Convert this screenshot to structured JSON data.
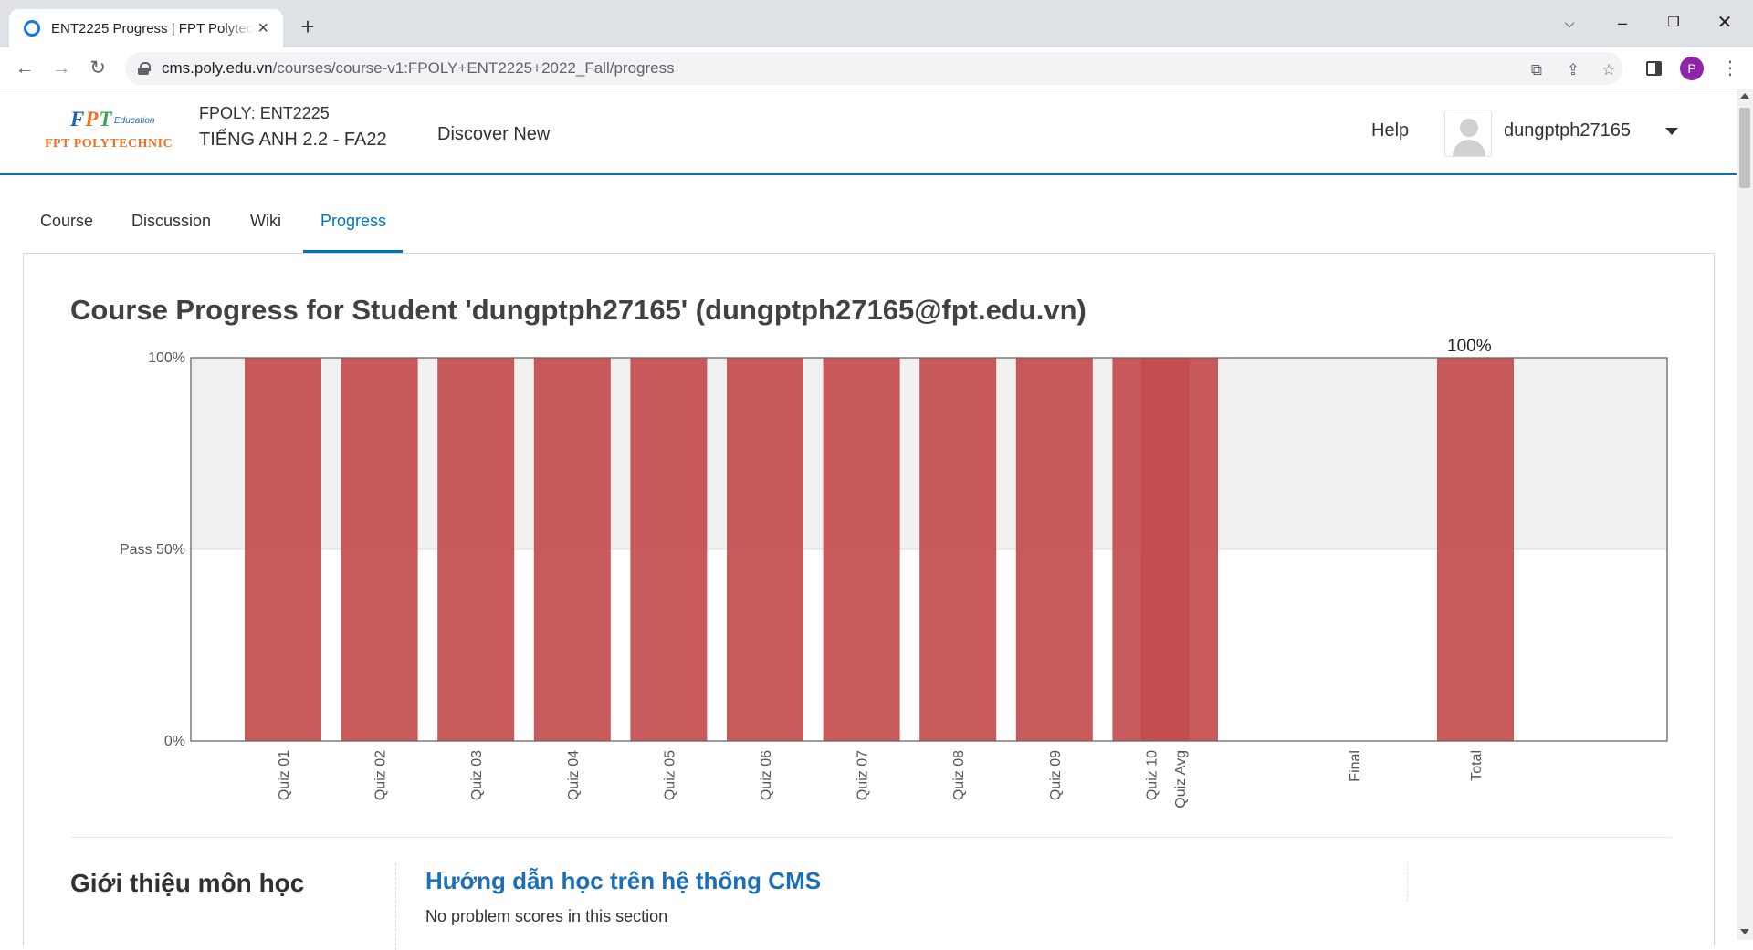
{
  "browser": {
    "tab_title": "ENT2225 Progress | FPT Polytechnic",
    "url_domain": "cms.poly.edu.vn",
    "url_path": "/courses/course-v1:FPOLY+ENT2225+2022_Fall/progress",
    "profile_initial": "P"
  },
  "header": {
    "logo_fpt": [
      "F",
      "P",
      "T"
    ],
    "logo_education": "Education",
    "logo_name": "FPT POLYTECHNIC",
    "course_org": "FPOLY: ENT2225",
    "course_name": "TIẾNG ANH 2.2 - FA22",
    "discover": "Discover New",
    "help": "Help",
    "username": "dungptph27165"
  },
  "tabs": [
    {
      "label": "Course",
      "active": false
    },
    {
      "label": "Discussion",
      "active": false
    },
    {
      "label": "Wiki",
      "active": false
    },
    {
      "label": "Progress",
      "active": true
    }
  ],
  "page_title": "Course Progress for Student 'dungptph27165' (dungptph27165@fpt.edu.vn)",
  "chart_data": {
    "type": "bar",
    "categories": [
      "Quiz 01",
      "Quiz 02",
      "Quiz 03",
      "Quiz 04",
      "Quiz 05",
      "Quiz 06",
      "Quiz 07",
      "Quiz 08",
      "Quiz 09",
      "Quiz 10",
      "Quiz Avg",
      "Final",
      "Total"
    ],
    "values": [
      100,
      100,
      100,
      100,
      100,
      100,
      100,
      100,
      100,
      100,
      100,
      0,
      100
    ],
    "ylim": [
      0,
      100
    ],
    "yticks": [
      {
        "value": 100,
        "label": "100%"
      },
      {
        "value": 50,
        "label": "Pass 50%"
      },
      {
        "value": 0,
        "label": "0%"
      }
    ],
    "pass_threshold": 50,
    "total_label": "100%",
    "bar_color": "#c44d4f",
    "pass_band_color": "#f1f1f1"
  },
  "section": {
    "title": "Giới thiệu môn học",
    "subsection_title": "Hướng dẫn học trên hệ thống CMS",
    "subsection_note": "No problem scores in this section"
  }
}
